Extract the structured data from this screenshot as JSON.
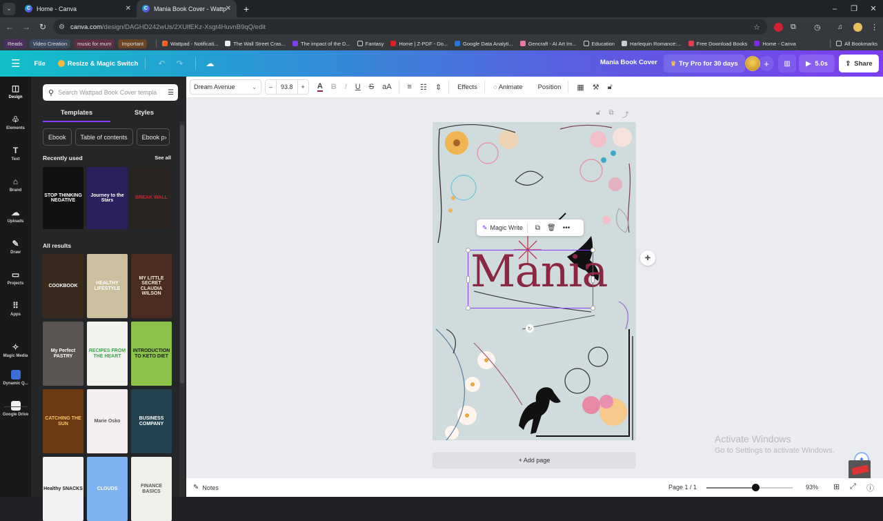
{
  "browser": {
    "tabs": [
      {
        "title": "Home - Canva",
        "active": false
      },
      {
        "title": "Mania Book Cover - Wattpad B",
        "active": true
      }
    ],
    "url_host": "canva.com",
    "url_path": "/design/DAGHD242wUs/2XUlfEKz-Xsgt4HuvnB9qQ/edit",
    "bookmark_chips": [
      {
        "label": "Reads",
        "color": "#4b2f5f"
      },
      {
        "label": "Video Creation",
        "color": "#3a4a5c"
      },
      {
        "label": "music for mum",
        "color": "#5c2f45"
      },
      {
        "label": "Important",
        "color": "#6b4424"
      }
    ],
    "bookmarks": [
      {
        "label": "Wattpad - Notificati...",
        "icon": "wattpad-icon",
        "color": "#ff6122"
      },
      {
        "label": "The Wall Street Cras...",
        "icon": "h-icon",
        "color": "#eeeeee"
      },
      {
        "label": "The impact of the D...",
        "icon": "purple-bars-icon",
        "color": "#7b3ef0"
      },
      {
        "label": "Fantasy",
        "icon": "folder-icon",
        "color": "#35393d"
      },
      {
        "label": "Home | Z-PDF - Do...",
        "icon": "z-icon",
        "color": "#e02020"
      },
      {
        "label": "Google Data Analyti...",
        "icon": "coursera-icon",
        "color": "#2a73d9"
      },
      {
        "label": "Gencraft - AI Art Im...",
        "icon": "gencraft-icon",
        "color": "#e87aa0"
      },
      {
        "label": "Education",
        "icon": "folder-icon",
        "color": "#35393d"
      },
      {
        "label": "Harlequin Romance:...",
        "icon": "image-icon",
        "color": "#cccccc"
      },
      {
        "label": "Free Download Books",
        "icon": "book-icon",
        "color": "#e04050"
      },
      {
        "label": "Home - Canva",
        "icon": "canva-icon",
        "color": "#7d2ae8"
      }
    ],
    "all_bookmarks": "All Bookmarks"
  },
  "header": {
    "file": "File",
    "resize": "Resize & Magic Switch",
    "design_title": "Mania Book Cover",
    "try_pro": "Try Pro for 30 days",
    "play_duration": "5.0s",
    "share": "Share"
  },
  "rail": [
    {
      "label": "Design",
      "icon": "design-icon",
      "glyph": "◫"
    },
    {
      "label": "Elements",
      "icon": "elements-icon",
      "glyph": "♧"
    },
    {
      "label": "Text",
      "icon": "text-icon",
      "glyph": "T"
    },
    {
      "label": "Brand",
      "icon": "brand-icon",
      "glyph": "⌂"
    },
    {
      "label": "Uploads",
      "icon": "uploads-icon",
      "glyph": "☁"
    },
    {
      "label": "Draw",
      "icon": "draw-icon",
      "glyph": "✎"
    },
    {
      "label": "Projects",
      "icon": "projects-icon",
      "glyph": "▭"
    },
    {
      "label": "Apps",
      "icon": "apps-icon",
      "glyph": "⠿"
    },
    {
      "label": "Magic Media",
      "icon": "magic-media-icon",
      "glyph": "✧"
    },
    {
      "label": "Dynamic Q...",
      "icon": "dynamic-qr-icon",
      "glyph": ""
    },
    {
      "label": "Google Drive",
      "icon": "google-drive-icon",
      "glyph": ""
    }
  ],
  "panel": {
    "search_placeholder": "Search Wattpad Book Cover templa",
    "tabs": [
      "Templates",
      "Styles"
    ],
    "chips": [
      "Ebook",
      "Table of contents",
      "Ebook p"
    ],
    "recently_used_heading": "Recently used",
    "see_all": "See all",
    "recently_used": [
      {
        "title": "STOP THINKING NEGATIVE",
        "bg": "#111111",
        "fg": "#ffffff"
      },
      {
        "title": "Journey to the Stars",
        "bg": "#2b1f5c",
        "fg": "#ffffff"
      },
      {
        "title": "BREAK WALL",
        "bg": "#2a2522",
        "fg": "#c0282d"
      }
    ],
    "all_results_heading": "All results",
    "all_results": [
      {
        "title": "COOKBOOK",
        "bg": "#3a2a1e",
        "fg": "#ffffff"
      },
      {
        "title": "HEALTHY LIFESTYLE",
        "bg": "#cbbf9f",
        "fg": "#ffffff"
      },
      {
        "title": "MY LITTLE SECRET CLAUDIA WILSON",
        "bg": "#4a2d20",
        "fg": "#f0e6d8"
      },
      {
        "title": "My Perfect PASTRY",
        "bg": "#5a5552",
        "fg": "#ffffff"
      },
      {
        "title": "RECIPES FROM THE HEART",
        "bg": "#f2f2ee",
        "fg": "#3aa84a"
      },
      {
        "title": "INTRODUCTION TO KETO DIET",
        "bg": "#8bc34a",
        "fg": "#1a1a1a"
      },
      {
        "title": "CATCHING THE SUN",
        "bg": "#6b3a12",
        "fg": "#f5c46a"
      },
      {
        "title": "Marie Osko",
        "bg": "#f3eef0",
        "fg": "#555555"
      },
      {
        "title": "BUSINESS COMPANY",
        "bg": "#23414f",
        "fg": "#ffffff"
      },
      {
        "title": "Healthy SNACKS",
        "bg": "#f2f2f2",
        "fg": "#222222"
      },
      {
        "title": "CLOUDS",
        "bg": "#7fb2f0",
        "fg": "#ffffff"
      },
      {
        "title": "FINANCE BASICS",
        "bg": "#f1efe9",
        "fg": "#555555"
      }
    ]
  },
  "toolbar": {
    "font": "Dream Avenue",
    "font_size": "93.8",
    "effects": "Effects",
    "animate": "Animate",
    "position": "Position",
    "text_color": "#8a2742"
  },
  "canvas": {
    "magic_write": "Magic Write",
    "title_text": "Mania",
    "add_page": "+ Add page",
    "background": "#cfdbdc"
  },
  "watermark": {
    "line1": "Activate Windows",
    "line2": "Go to Settings to activate Windows."
  },
  "bottom": {
    "notes": "Notes",
    "page_indicator": "Page 1 / 1",
    "zoom_label": "93%",
    "zoom_slider_fraction": 0.57
  }
}
